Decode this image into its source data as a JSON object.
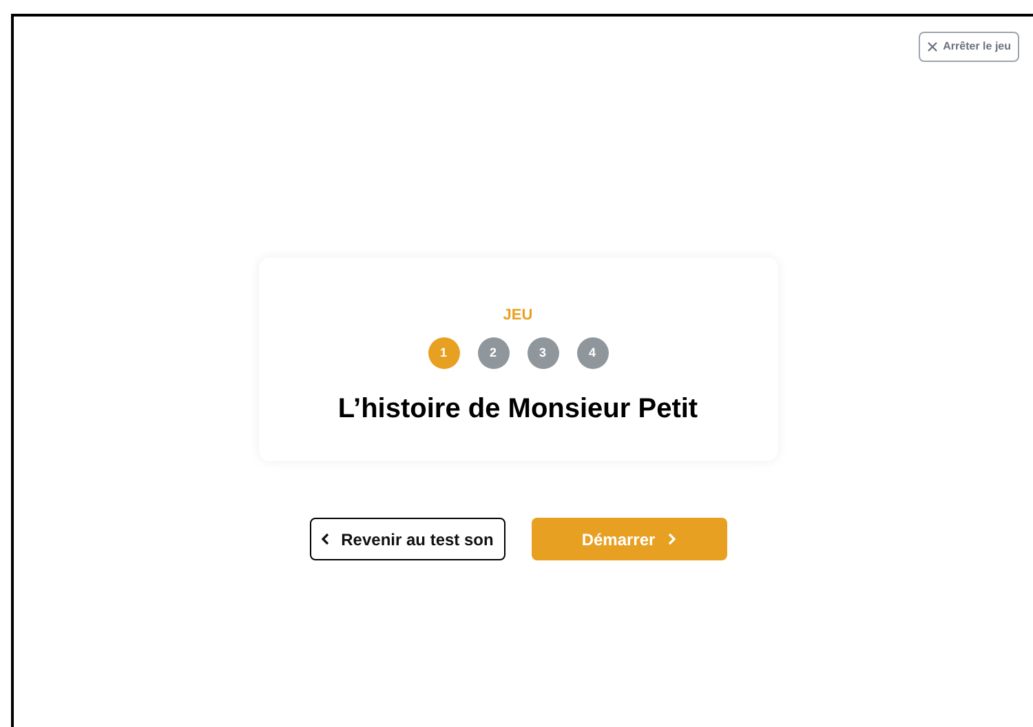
{
  "close_button": {
    "label": "Arrêter le jeu"
  },
  "card": {
    "eyebrow": "JEU",
    "steps": [
      {
        "label": "1",
        "selected": true
      },
      {
        "label": "2",
        "selected": false
      },
      {
        "label": "3",
        "selected": false
      },
      {
        "label": "4",
        "selected": false
      }
    ],
    "title": "L’histoire de Monsieur Petit"
  },
  "buttons": {
    "back": "Revenir au test son",
    "start": "Démarrer"
  }
}
